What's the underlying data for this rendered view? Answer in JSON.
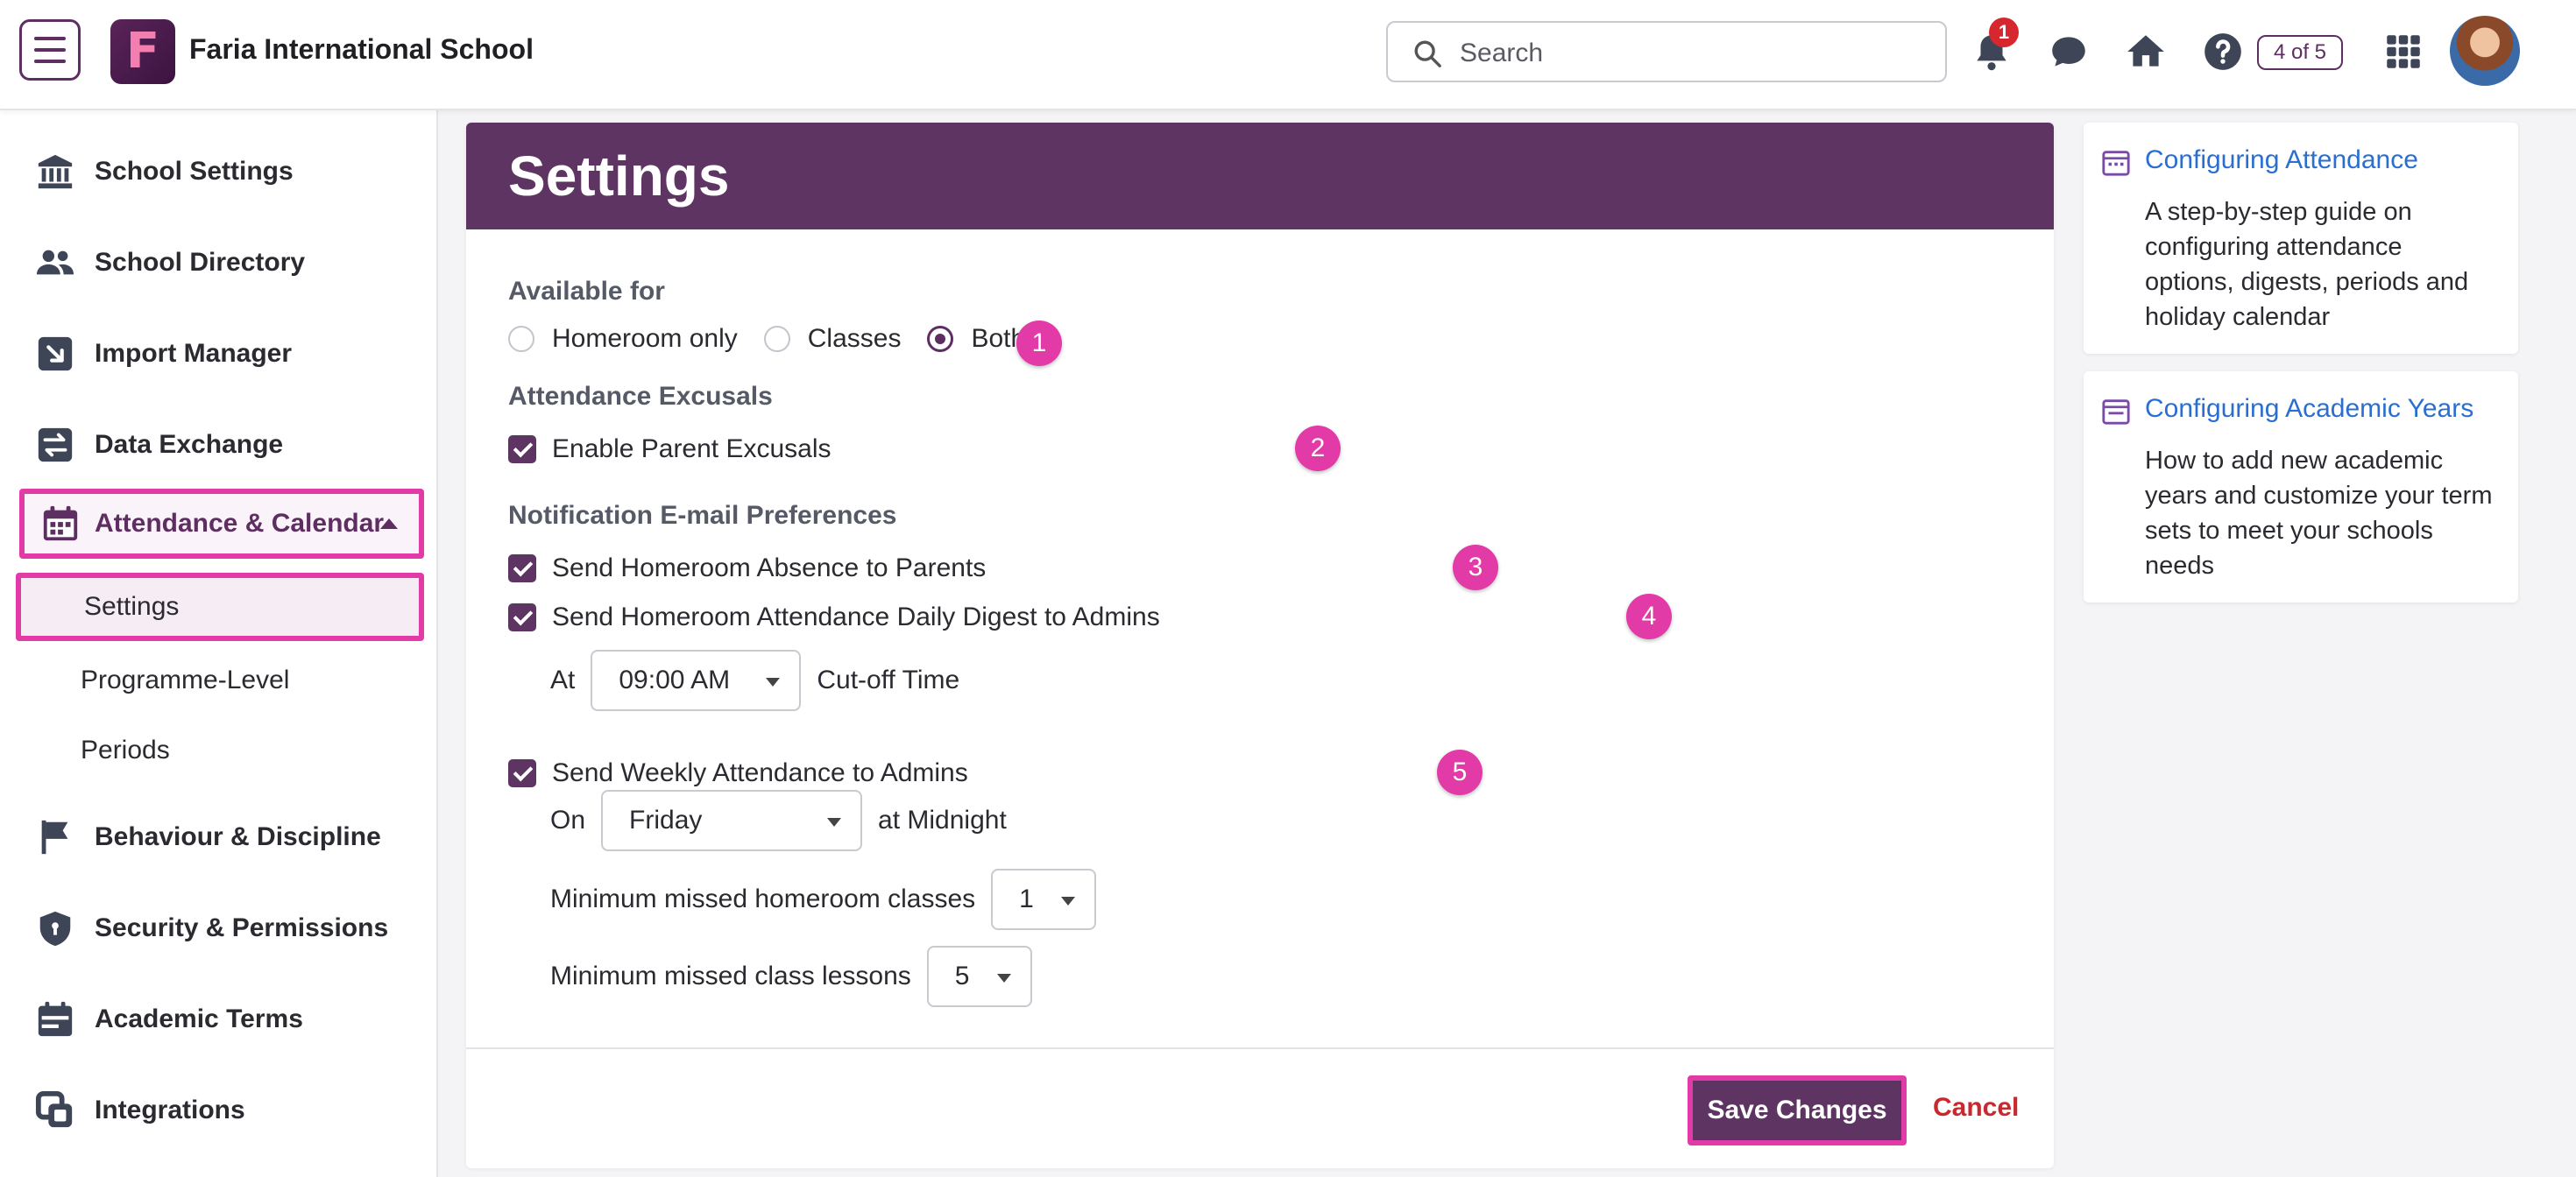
{
  "header": {
    "school_name": "Faria International School",
    "logo_letter": "F",
    "search_placeholder": "Search",
    "notification_count": "1",
    "tour_progress": "4 of 5"
  },
  "sidebar": {
    "items": [
      {
        "label": "School Settings",
        "icon": "bank-icon"
      },
      {
        "label": "School Directory",
        "icon": "people-icon"
      },
      {
        "label": "Import Manager",
        "icon": "import-icon"
      },
      {
        "label": "Data Exchange",
        "icon": "exchange-icon"
      },
      {
        "label": "Attendance & Calendar",
        "icon": "calendar-icon"
      },
      {
        "label": "Behaviour & Discipline",
        "icon": "flag-icon"
      },
      {
        "label": "Security & Permissions",
        "icon": "shield-icon"
      },
      {
        "label": "Academic Terms",
        "icon": "terms-icon"
      },
      {
        "label": "Integrations",
        "icon": "integrations-icon"
      }
    ],
    "sub_items": [
      "Settings",
      "Programme-Level",
      "Periods"
    ]
  },
  "settings": {
    "title": "Settings",
    "available_for_label": "Available for",
    "available_options": [
      "Homeroom only",
      "Classes",
      "Both"
    ],
    "available_selected": "Both",
    "excusals_label": "Attendance Excusals",
    "enable_parent_excusals": "Enable Parent Excusals",
    "notification_label": "Notification E-mail Preferences",
    "send_homeroom_absence": "Send Homeroom Absence to Parents",
    "send_daily_digest": "Send Homeroom Attendance Daily Digest to Admins",
    "at_label": "At",
    "cutoff_time": "09:00 AM",
    "cutoff_label": "Cut-off Time",
    "send_weekly": "Send Weekly Attendance to Admins",
    "on_label": "On",
    "weekly_day": "Friday",
    "at_midnight": "at Midnight",
    "min_homeroom_label": "Minimum missed homeroom classes",
    "min_homeroom_value": "1",
    "min_class_label": "Minimum missed class lessons",
    "min_class_value": "5",
    "save_label": "Save Changes",
    "cancel_label": "Cancel"
  },
  "markers": [
    "1",
    "2",
    "3",
    "4",
    "5"
  ],
  "help": [
    {
      "title": "Configuring Attendance",
      "desc": "A step-by-step guide on configuring attendance options, digests, periods and holiday calendar"
    },
    {
      "title": "Configuring Academic Years",
      "desc": "How to add new academic years and customize your term sets to meet your schools needs"
    }
  ],
  "colors": {
    "brand": "#5e3462",
    "highlight": "#e23aa7",
    "link": "#2a6fd0",
    "cancel": "#c8282e"
  }
}
